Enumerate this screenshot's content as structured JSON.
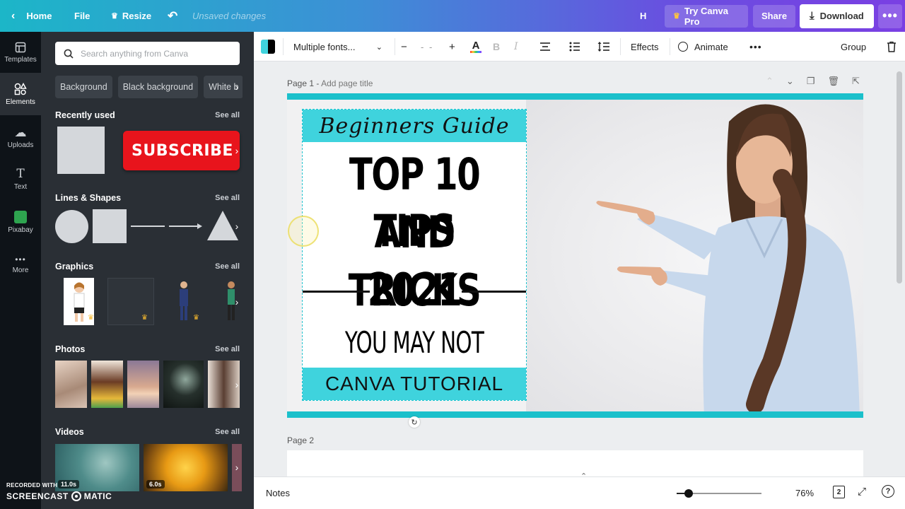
{
  "topbar": {
    "home": "Home",
    "file": "File",
    "resize": "Resize",
    "status": "Unsaved changes",
    "user_initial": "H",
    "try_pro": "Try Canva Pro",
    "share": "Share",
    "download": "Download"
  },
  "sidenav": {
    "items": [
      {
        "label": "Templates",
        "icon": "templates-icon"
      },
      {
        "label": "Elements",
        "icon": "elements-icon"
      },
      {
        "label": "Uploads",
        "icon": "uploads-icon"
      },
      {
        "label": "Text",
        "icon": "text-icon"
      },
      {
        "label": "Pixabay",
        "icon": "pixabay-icon"
      },
      {
        "label": "More",
        "icon": "more-icon"
      }
    ]
  },
  "panel": {
    "search_placeholder": "Search anything from Canva",
    "chips": [
      "Background",
      "Black background",
      "White b"
    ],
    "see_all": "See all",
    "sections": {
      "recent": "Recently used",
      "lines": "Lines & Shapes",
      "graphics": "Graphics",
      "photos": "Photos",
      "videos": "Videos"
    },
    "subscribe_text": "SUBSCRIBE",
    "video_durations": [
      "11.0s",
      "6.0s"
    ]
  },
  "toolbar": {
    "font": "Multiple fonts...",
    "font_size": "- -",
    "effects": "Effects",
    "animate": "Animate",
    "group": "Group"
  },
  "pages": {
    "page1_label": "Page 1",
    "page1_add": "Add page title",
    "page2_label": "Page 2"
  },
  "design": {
    "heading": "Beginners Guide",
    "line1": "TOP 10 TIPS",
    "line2": "AND TRICKS",
    "year": "2021",
    "line4": "YOU MAY NOT KNOW",
    "footer": "CANVA TUTORIAL"
  },
  "bottombar": {
    "notes": "Notes",
    "zoom": "76%",
    "page_count": "2"
  },
  "watermark": {
    "line1": "RECORDED WITH",
    "line2a": "SCREENCAST",
    "line2b": "MATIC"
  },
  "colors": {
    "accent_cyan": "#1bc0cb",
    "band_cyan": "#3fd3dd",
    "subscribe_red": "#e8141c"
  }
}
